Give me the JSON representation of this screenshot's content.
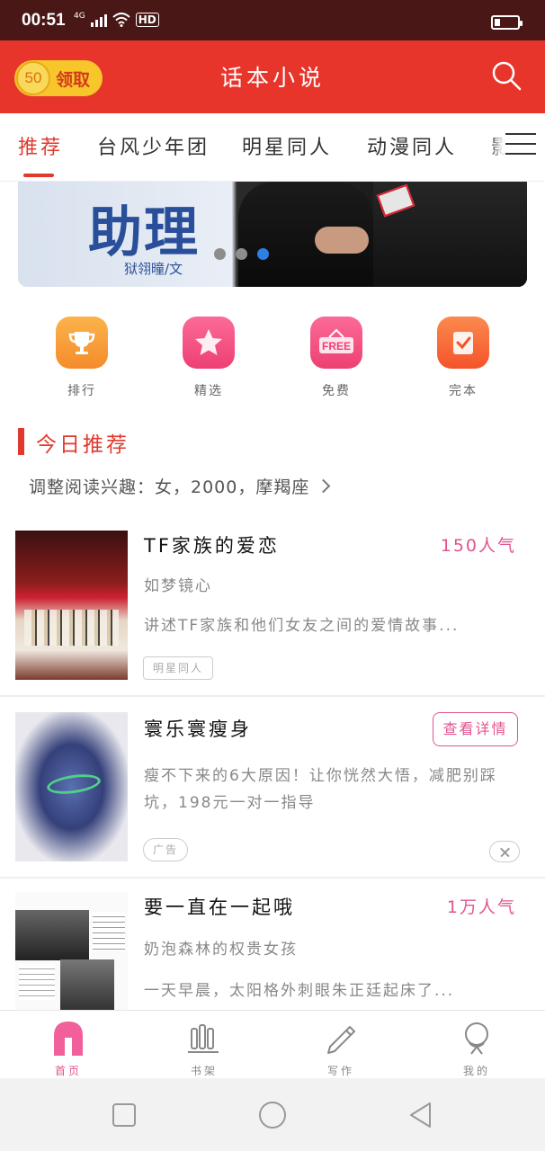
{
  "status_bar": {
    "time": "00:51",
    "network": "4G",
    "hd": "HD"
  },
  "header": {
    "coin_amount": "50",
    "claim_label": "领取",
    "title": "话本小说"
  },
  "tabs": [
    {
      "label": "推荐",
      "active": true
    },
    {
      "label": "台风少年团"
    },
    {
      "label": "明星同人"
    },
    {
      "label": "动漫同人"
    },
    {
      "label": "影"
    }
  ],
  "banner": {
    "title": "助理",
    "author": "狱翎曈/文",
    "slides": 3,
    "active_slide": 3
  },
  "quick_nav": [
    {
      "label": "排行",
      "icon": "trophy-icon",
      "color": "#f59a2e"
    },
    {
      "label": "精选",
      "icon": "star-icon",
      "color": "#f0477a"
    },
    {
      "label": "免费",
      "icon": "free-sign-icon",
      "color": "#f0477a",
      "badge": "FREE"
    },
    {
      "label": "完本",
      "icon": "checklist-icon",
      "color": "#f56a34"
    }
  ],
  "section": {
    "title": "今日推荐",
    "preference": "调整阅读兴趣：女，2000，摩羯座"
  },
  "books": [
    {
      "title": "TF家族的爱恋",
      "popularity": "150人气",
      "author": "如梦镜心",
      "description": "讲述TF家族和他们女友之间的爱情故事...",
      "tag": "明星同人"
    },
    {
      "title": "寰乐寰瘦身",
      "action": "查看详情",
      "description": "瘦不下来的6大原因！让你恍然大悟，减肥别踩坑，198元一对一指导",
      "tag": "广告"
    },
    {
      "title": "要一直在一起哦",
      "popularity": "1万人气",
      "author": "奶泡森林的权贵女孩",
      "description": "一天早晨，太阳格外刺眼朱正廷起床了..."
    }
  ],
  "bottom_nav": [
    {
      "label": "首页",
      "active": true
    },
    {
      "label": "书架"
    },
    {
      "label": "写作"
    },
    {
      "label": "我的"
    }
  ],
  "colors": {
    "brand_red": "#e8352c",
    "accent_pink": "#e0558f",
    "status_bar": "#4a1717"
  }
}
